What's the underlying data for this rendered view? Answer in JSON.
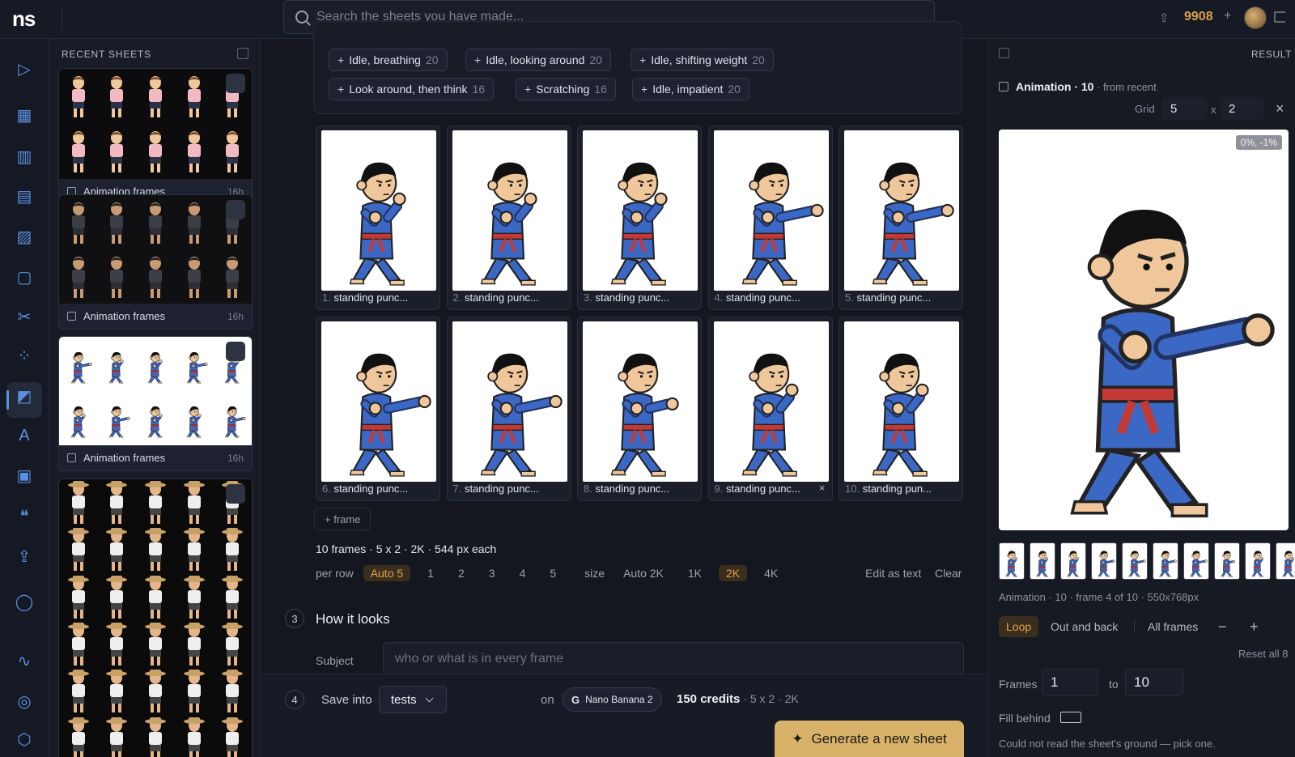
{
  "app": {
    "logo": "ns",
    "credits": "9908",
    "credits_plus": "+",
    "search_placeholder": "Search the sheets you have made..."
  },
  "sidebar": {
    "title": "RECENT SHEETS",
    "cards": [
      {
        "label": "Animation frames",
        "age": "16h",
        "style": "pink"
      },
      {
        "label": "Animation frames",
        "age": "16h",
        "style": "dark"
      },
      {
        "label": "Animation frames",
        "age": "16h",
        "style": "karate"
      },
      {
        "label": "",
        "age": "",
        "style": "cowboy"
      }
    ]
  },
  "chips": [
    {
      "label": "Idle, breathing",
      "count": "20"
    },
    {
      "label": "Idle, looking around",
      "count": "20"
    },
    {
      "label": "Idle, shifting weight",
      "count": "20"
    },
    {
      "label": "Look around, then think",
      "count": "16"
    },
    {
      "label": "Scratching",
      "count": "16"
    },
    {
      "label": "Idle, impatient",
      "count": "20"
    }
  ],
  "frames": [
    {
      "num": "1.",
      "label": "standing punc...",
      "pose": 0
    },
    {
      "num": "2.",
      "label": "standing punc...",
      "pose": 0
    },
    {
      "num": "3.",
      "label": "standing punc...",
      "pose": 0
    },
    {
      "num": "4.",
      "label": "standing punc...",
      "pose": 2
    },
    {
      "num": "5.",
      "label": "standing punc...",
      "pose": 2
    },
    {
      "num": "6.",
      "label": "standing punc...",
      "pose": 2
    },
    {
      "num": "7.",
      "label": "standing punc...",
      "pose": 2
    },
    {
      "num": "8.",
      "label": "standing punc...",
      "pose": 1
    },
    {
      "num": "9.",
      "label": "standing punc...",
      "pose": 0
    },
    {
      "num": "10.",
      "label": "standing pun...",
      "pose": 0
    }
  ],
  "frame_close": "×",
  "add_frame": "+ frame",
  "frames_info": "10 frames · 5 x 2 · 2K · 544 px each",
  "per_row": {
    "label": "per row",
    "options": [
      "Auto 5",
      "1",
      "2",
      "3",
      "4",
      "5"
    ]
  },
  "size": {
    "label": "size",
    "options": [
      "Auto 2K",
      "1K",
      "2K",
      "4K"
    ]
  },
  "edit_as_text": "Edit as text",
  "clear": "Clear",
  "section3": {
    "num": "3",
    "title": "How it looks",
    "subject_label": "Subject",
    "subject_placeholder": "who or what is in every frame"
  },
  "section4": {
    "num": "4",
    "save_into": "Save into",
    "folder": "tests",
    "on": "on",
    "model": "Nano Banana 2",
    "credits": "150 credits",
    "credits_detail": " · 5 x 2 · 2K"
  },
  "generate": "Generate a new sheet",
  "right": {
    "result_label": "RESULT",
    "anim_title": "Animation · 10",
    "from_recent": " · from recent",
    "grid_label": "Grid",
    "grid_x": "5",
    "grid_x_sep": "x",
    "grid_y": "2",
    "close": "×",
    "offset": "0%, -1%",
    "status": "Animation · 10 · frame 4 of 10 · 550x768px",
    "loop": "Loop",
    "out_and_back": "Out and back",
    "all_frames": "All frames",
    "minus": "−",
    "plus": "+",
    "reset": "Reset all 8",
    "frames_label": "Frames",
    "frame_from": "1",
    "to_label": "to",
    "frame_to": "10",
    "fill_behind": "Fill behind",
    "note": "Could not read the sheet's ground — pick one."
  }
}
